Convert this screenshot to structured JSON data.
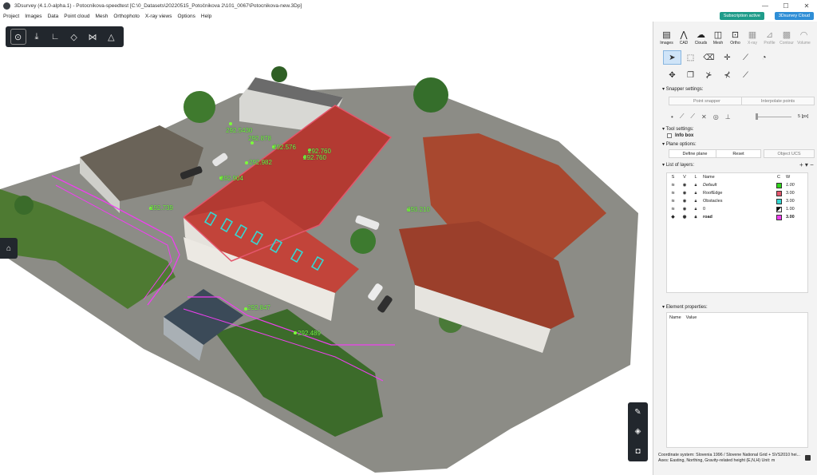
{
  "window": {
    "title": "3Dsurvey (4.1.0-alpha.1) - Potocnikova-speedtest [C:\\0_Datasets\\20220515_Potočnikova 2\\101_0067\\Potocnikova-new.3Dp]",
    "minimize": "—",
    "maximize": "☐",
    "close": "✕"
  },
  "menu": [
    "Project",
    "Images",
    "Data",
    "Point cloud",
    "Mesh",
    "Orthophoto",
    "X-ray views",
    "Options",
    "Help"
  ],
  "header_buttons": {
    "subscription": "Subscription active",
    "cloud": "3Dsurvey Cloud"
  },
  "viewport": {
    "top_toolbar_icons": [
      "target-icon",
      "download-icon",
      "axes-icon",
      "cube-icon",
      "grid-icon",
      "pyramid-icon"
    ],
    "point_labels": [
      "292.5430",
      "292.878",
      "292.576",
      "292.760",
      "292.760",
      "292.982",
      "292.904",
      "292.739",
      "293.210",
      "292.847",
      "292.489"
    ]
  },
  "panel": {
    "tabs": [
      {
        "label": "Images",
        "icon": "images-icon"
      },
      {
        "label": "CAD",
        "icon": "cad-icon"
      },
      {
        "label": "Clouds",
        "icon": "cloud-icon"
      },
      {
        "label": "Mesh",
        "icon": "mesh-icon"
      },
      {
        "label": "Ortho",
        "icon": "ortho-icon"
      },
      {
        "label": "X-ray",
        "icon": "xray-icon"
      },
      {
        "label": "Profile",
        "icon": "profile-icon"
      },
      {
        "label": "Contour",
        "icon": "contour-icon"
      },
      {
        "label": "Volume",
        "icon": "volume-icon"
      }
    ],
    "snapper": {
      "title": "Snapper settings:",
      "point_snapper": "Point snapper",
      "interpolate": "Interpolate points",
      "value": "5 [px]"
    },
    "tool_settings": {
      "title": "Tool settings:",
      "info_box": "Info box"
    },
    "plane_options": {
      "title": "Plane options:",
      "define": "Define plane",
      "reset": "Reset",
      "object_ucs": "Object UCS"
    },
    "layers": {
      "title": "List of layers:",
      "add": "+",
      "remove": "−",
      "more": "▾",
      "headers": {
        "s": "S",
        "v": "V",
        "l": "L",
        "name": "Name",
        "c": "C",
        "w": "W"
      },
      "rows": [
        {
          "name": "Default",
          "color": "#2fd61a",
          "w": "1.00"
        },
        {
          "name": "RoofEdge",
          "color": "#e4566c",
          "w": "3.00"
        },
        {
          "name": "Obstacles",
          "color": "#34d9d4",
          "w": "3.00"
        },
        {
          "name": "0",
          "color": "#000000",
          "w": "1.00"
        },
        {
          "name": "road",
          "color": "#ef3ff0",
          "w": "3.00"
        }
      ]
    },
    "element_properties": {
      "title": "Element properties:",
      "col_name": "Name",
      "col_value": "Value"
    },
    "status": {
      "line1": "Coordinate system: Slovenia 1996 / Slovene National Grid + SVS2010 hei...",
      "line2": "Axes: Easting, Northing, Gravity-related height (E,N,H) Unit: m"
    }
  }
}
